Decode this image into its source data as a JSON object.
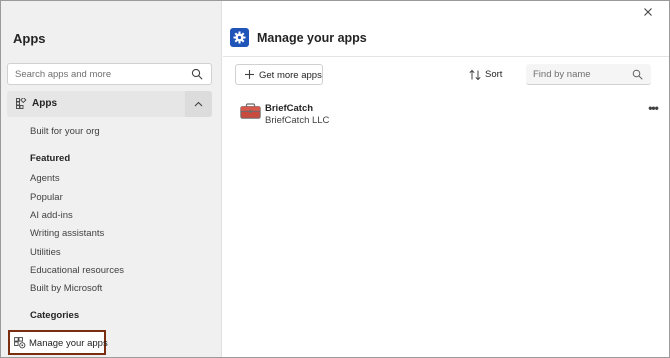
{
  "sidebar": {
    "title": "Apps",
    "search_placeholder": "Search apps and more",
    "apps_section_label": "Apps",
    "items": [
      {
        "label": "Built for your org"
      }
    ],
    "featured_header": "Featured",
    "featured_items": [
      {
        "label": "Agents"
      },
      {
        "label": "Popular"
      },
      {
        "label": "AI add-ins"
      },
      {
        "label": "Writing assistants"
      },
      {
        "label": "Utilities"
      },
      {
        "label": "Educational resources"
      },
      {
        "label": "Built by Microsoft"
      }
    ],
    "categories_header": "Categories",
    "manage_label": "Manage your apps"
  },
  "main": {
    "title": "Manage your apps",
    "get_more_label": "Get more apps",
    "sort_label": "Sort",
    "find_placeholder": "Find by name",
    "apps": [
      {
        "name": "BriefCatch",
        "publisher": "BriefCatch LLC"
      }
    ],
    "more_glyph": "•••"
  },
  "colors": {
    "accent_blue": "#1f55b8",
    "highlight_border": "#7a2e0f",
    "sidebar_bg": "#f0f0f0",
    "app_icon_red": "#c94a3f"
  },
  "icons": [
    "search-icon",
    "apps-grid-icon",
    "chevron-up-icon",
    "manage-apps-icon",
    "close-icon",
    "settings-gear-icon",
    "plus-icon",
    "sort-icon",
    "briefcatch-app-icon",
    "more-options-icon"
  ]
}
